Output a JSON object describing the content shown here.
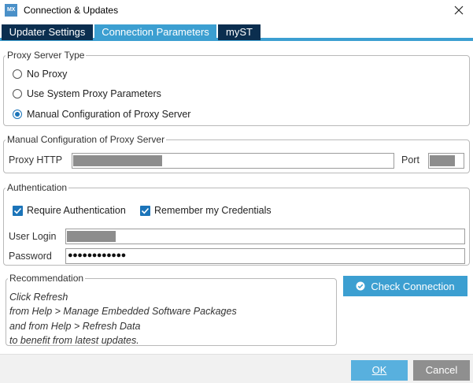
{
  "window": {
    "app_icon_text": "MX",
    "title": "Connection & Updates",
    "close_icon": "close-icon"
  },
  "tabs": [
    {
      "label": "Updater Settings",
      "active": false
    },
    {
      "label": "Connection Parameters",
      "active": true
    },
    {
      "label": "myST",
      "active": false
    }
  ],
  "proxy_server_type": {
    "legend": "Proxy Server Type",
    "options": [
      {
        "label": "No Proxy",
        "selected": false
      },
      {
        "label": "Use System Proxy Parameters",
        "selected": false
      },
      {
        "label": "Manual Configuration of Proxy Server",
        "selected": true
      }
    ]
  },
  "manual_config": {
    "legend": "Manual Configuration of Proxy Server",
    "proxy_http_label": "Proxy HTTP",
    "port_label": "Port"
  },
  "authentication": {
    "legend": "Authentication",
    "require_auth_label": "Require Authentication",
    "require_auth_checked": true,
    "remember_label": "Remember my Credentials",
    "remember_checked": true,
    "user_login_label": "User Login",
    "password_label": "Password",
    "password_value": "●●●●●●●●●●●●"
  },
  "recommendation": {
    "legend": "Recommendation",
    "lines": [
      "Click Refresh",
      "from Help > Manage Embedded Software Packages",
      "and from Help > Refresh Data",
      "to benefit from latest updates."
    ]
  },
  "buttons": {
    "check_connection": "Check Connection",
    "ok": "OK",
    "cancel": "Cancel"
  },
  "colors": {
    "accent": "#3c9fd1",
    "tab_inactive": "#0b2e4f",
    "checkbox": "#1b74b9"
  }
}
